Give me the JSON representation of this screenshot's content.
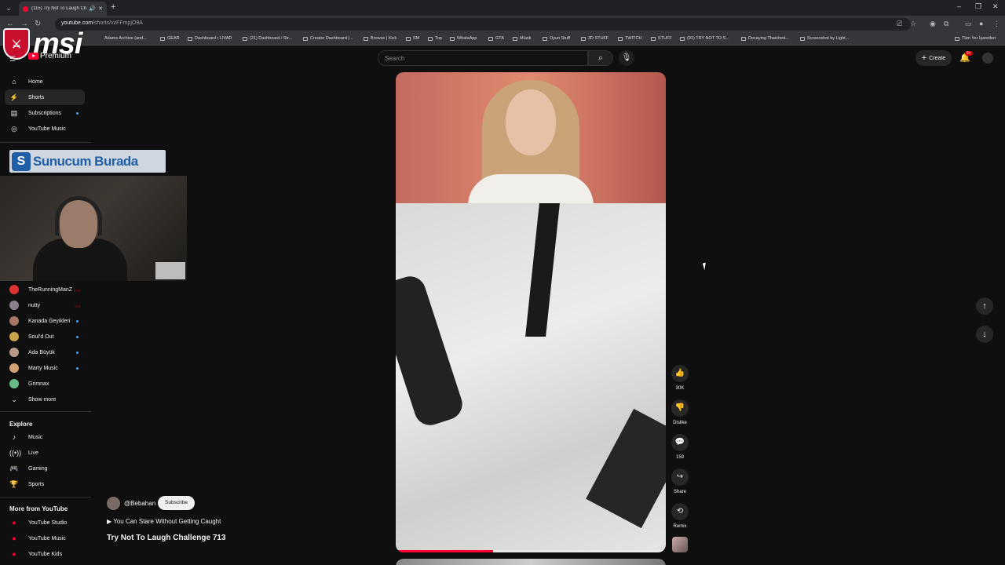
{
  "browser": {
    "tab_title": "(115) Try Not To Laugh Ch",
    "url_host": "youtube.com",
    "url_path": "/shorts/vzFFmpjO9A",
    "bookmarks": [
      {
        "label": "Adams Archive (and..."
      },
      {
        "label": "GEAR"
      },
      {
        "label": "Dashboard • LIVAD"
      },
      {
        "label": "(21) Dashboard / Str..."
      },
      {
        "label": "Creator Dashboard |..."
      },
      {
        "label": "Browse | Kick"
      },
      {
        "label": "SM"
      },
      {
        "label": "Top"
      },
      {
        "label": "WhatsApp"
      },
      {
        "label": "GTA"
      },
      {
        "label": "Müzik"
      },
      {
        "label": "Oyun Stuff"
      },
      {
        "label": "3D STUFF"
      },
      {
        "label": "TWITCH"
      },
      {
        "label": "STUFF"
      },
      {
        "label": "(91) TRY NOT TO S..."
      },
      {
        "label": "Decaying Thatched..."
      },
      {
        "label": "Screenshot by Light..."
      },
      {
        "label": "Tüm Yer İşaretleri"
      }
    ]
  },
  "overlay": {
    "msi_logo_text": "msi",
    "banner_text": "Sunucum Burada"
  },
  "header": {
    "logo_text": "Premium",
    "search_placeholder": "Search",
    "create_label": "Create",
    "notification_count": "9+"
  },
  "sidebar": {
    "main": [
      {
        "label": "Home",
        "icon": "home-icon"
      },
      {
        "label": "Shorts",
        "icon": "shorts-icon"
      },
      {
        "label": "Subscriptions",
        "icon": "subscriptions-icon"
      },
      {
        "label": "YouTube Music",
        "icon": "music-icon"
      }
    ],
    "subscriptions": [
      {
        "label": "TheRunningManZ",
        "live": true
      },
      {
        "label": "nutty",
        "live": true
      },
      {
        "label": "Kanada Geyikleri",
        "live": false
      },
      {
        "label": "Soul'd Out",
        "live": false
      },
      {
        "label": "Ada Büyük",
        "live": false
      },
      {
        "label": "Marty Music",
        "live": false
      },
      {
        "label": "Grimnax",
        "live": false
      }
    ],
    "show_more": "Show more",
    "explore_heading": "Explore",
    "explore": [
      {
        "label": "Music"
      },
      {
        "label": "Live"
      },
      {
        "label": "Gaming"
      },
      {
        "label": "Sports"
      }
    ],
    "more_heading": "More from YouTube",
    "more": [
      {
        "label": "YouTube Studio"
      },
      {
        "label": "YouTube Music"
      },
      {
        "label": "YouTube Kids"
      }
    ]
  },
  "short": {
    "channel": "@Bebahan",
    "subscribe_label": "Subscribe",
    "playlist": "▶ You Can Stare Without Getting Caught",
    "title": "Try Not To Laugh Challenge 713",
    "progress_fraction": 0.36,
    "actions": {
      "likes": "30K",
      "dislike": "Dislike",
      "comments": "159",
      "share": "Share",
      "remix": "Remix"
    }
  }
}
